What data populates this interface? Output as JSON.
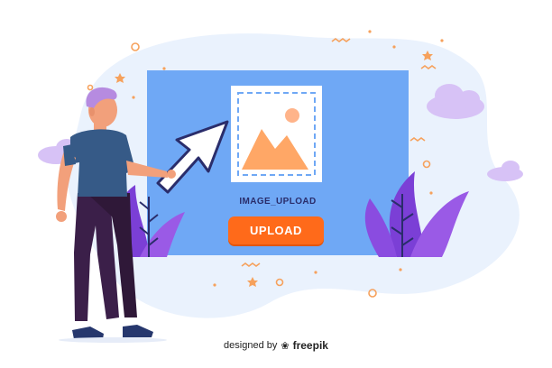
{
  "upload": {
    "label": "IMAGE_UPLOAD",
    "button_label": "UPLOAD"
  },
  "credit": {
    "prefix": "designed by",
    "brand": "freepik"
  },
  "colors": {
    "panel": "#6fa8f5",
    "button": "#ff6a1a",
    "blob": "#eaf2fd",
    "plant": "#7b3fd6",
    "cloud": "#d7c2f6"
  },
  "icons": [
    "image-placeholder-icon",
    "pointer-arrow-icon",
    "freepik-logo-icon"
  ]
}
